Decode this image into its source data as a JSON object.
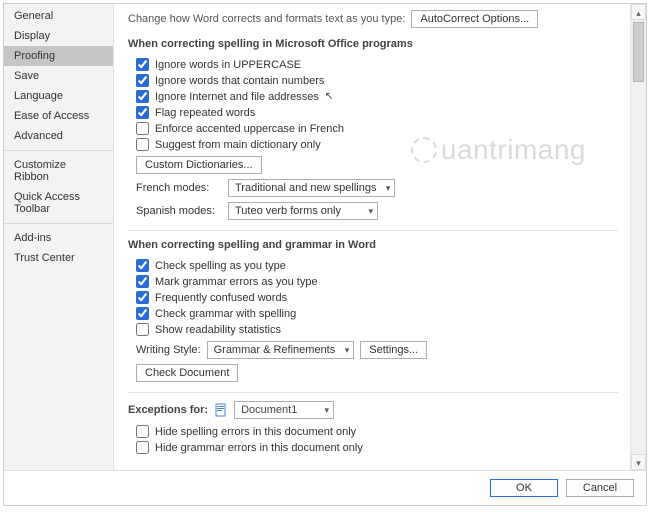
{
  "sidebar": {
    "items": [
      {
        "label": "General"
      },
      {
        "label": "Display"
      },
      {
        "label": "Proofing"
      },
      {
        "label": "Save"
      },
      {
        "label": "Language"
      },
      {
        "label": "Ease of Access"
      },
      {
        "label": "Advanced"
      },
      {
        "label": "Customize Ribbon"
      },
      {
        "label": "Quick Access Toolbar"
      },
      {
        "label": "Add-ins"
      },
      {
        "label": "Trust Center"
      }
    ]
  },
  "intro": {
    "text": "Change how Word corrects and formats text as you type:",
    "autocorrect_btn": "AutoCorrect Options..."
  },
  "section1": {
    "title": "When correcting spelling in Microsoft Office programs",
    "opt_uppercase": "Ignore words in UPPERCASE",
    "opt_numbers": "Ignore words that contain numbers",
    "opt_internet": "Ignore Internet and file addresses",
    "opt_repeated": "Flag repeated words",
    "opt_french_accent": "Enforce accented uppercase in French",
    "opt_main_dict": "Suggest from main dictionary only",
    "custom_dict_btn": "Custom Dictionaries...",
    "french_label": "French modes:",
    "french_value": "Traditional and new spellings",
    "spanish_label": "Spanish modes:",
    "spanish_value": "Tuteo verb forms only"
  },
  "section2": {
    "title": "When correcting spelling and grammar in Word",
    "opt_spell_type": "Check spelling as you type",
    "opt_grammar_type": "Mark grammar errors as you type",
    "opt_confused": "Frequently confused words",
    "opt_grammar_spell": "Check grammar with spelling",
    "opt_readability": "Show readability statistics",
    "writing_label": "Writing Style:",
    "writing_value": "Grammar & Refinements",
    "settings_btn": "Settings...",
    "check_doc_btn": "Check Document"
  },
  "section3": {
    "title": "Exceptions for:",
    "doc_value": "Document1",
    "opt_hide_spell": "Hide spelling errors in this document only",
    "opt_hide_grammar": "Hide grammar errors in this document only"
  },
  "footer": {
    "ok": "OK",
    "cancel": "Cancel"
  },
  "watermark": "uantrimang"
}
